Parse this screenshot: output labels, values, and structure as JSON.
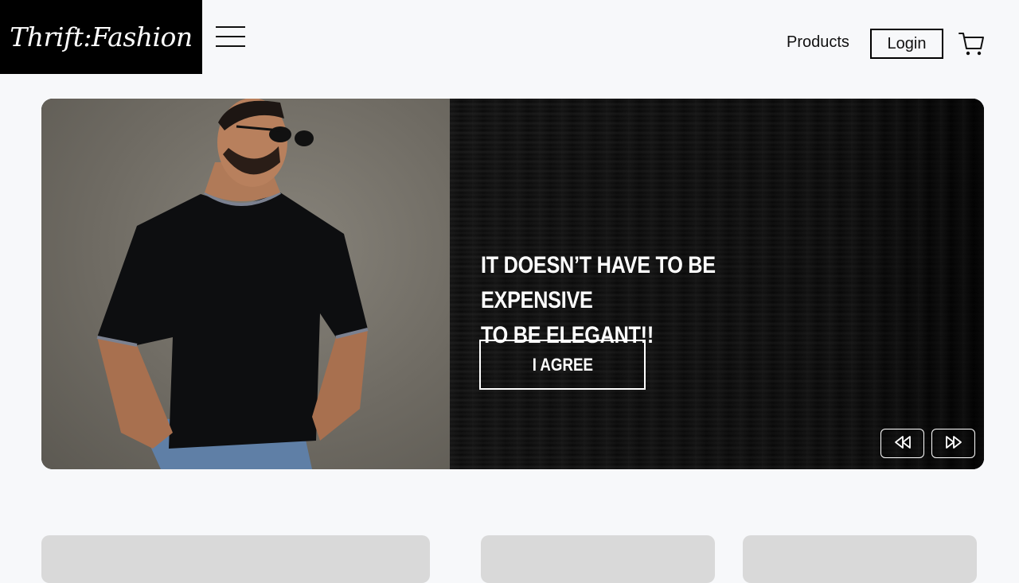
{
  "header": {
    "logo_text": "Thrift:Fashion",
    "nav": {
      "products_label": "Products",
      "login_label": "Login"
    },
    "icons": {
      "menu": "hamburger-menu-icon",
      "cart": "shopping-cart-icon"
    }
  },
  "hero": {
    "headline_line1": "IT DOESN’T HAVE TO BE EXPENSIVE",
    "headline_line2": "TO BE ELEGANT!!",
    "cta_label": "I AGREE",
    "photo": "man-in-black-tshirt-sunglasses-photo",
    "controls": {
      "prev_icon": "rewind-icon",
      "next_icon": "fast-forward-icon"
    }
  },
  "colors": {
    "background": "#f7f8fa",
    "logo_bg": "#000000",
    "card": "#d9d9d9"
  }
}
